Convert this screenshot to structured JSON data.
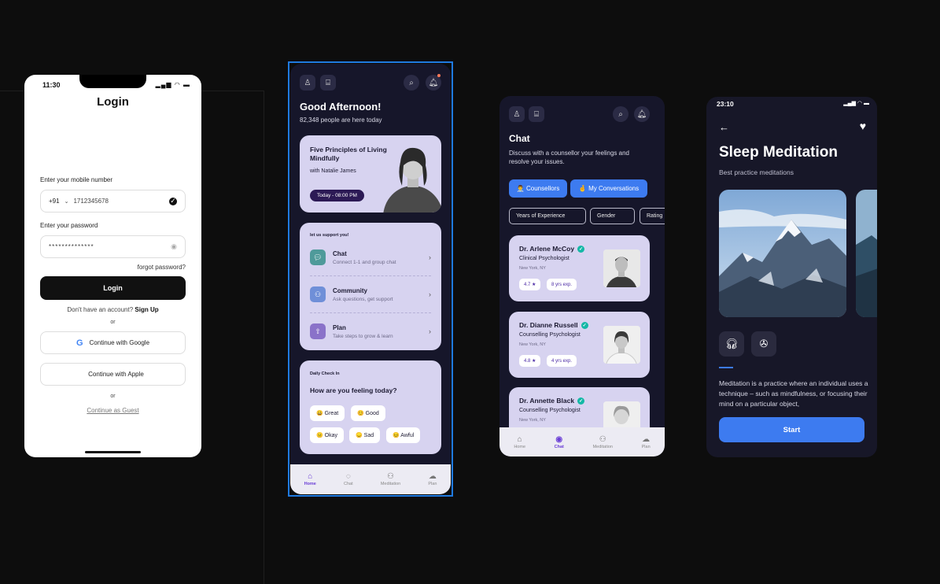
{
  "login": {
    "time": "11:30",
    "title": "Login",
    "mobile_label": "Enter your mobile number",
    "country_code": "+91",
    "phone_value": "1712345678",
    "password_label": "Enter your password",
    "password_value": "**************",
    "forgot": "forgot password?",
    "login_button": "Login",
    "no_account": "Don't have an account?",
    "signup": "Sign Up",
    "or1": "or",
    "google": "Continue with Google",
    "apple": "Continue with Apple",
    "or2": "or",
    "guest": "Continue as Guest"
  },
  "home": {
    "greeting": "Good Afternoon!",
    "people_count": "82,348 people are here today",
    "hero": {
      "title": "Five Principles of Living Mindfully",
      "host": "with Natalie James",
      "time_pill": "Today - 08:00 PM"
    },
    "support": {
      "caption": "let us support you!",
      "items": [
        {
          "title": "Chat",
          "subtitle": "Connect 1-1 and group chat",
          "color": "#4f9a9a"
        },
        {
          "title": "Community",
          "subtitle": "Ask questions, get support",
          "color": "#6f8fd8"
        },
        {
          "title": "Plan",
          "subtitle": "Take steps to grow & learn",
          "color": "#8a72c9"
        }
      ]
    },
    "checkin": {
      "caption": "Daily Check In",
      "question": "How are you feeling today?",
      "moods": [
        "😀 Great",
        "😊 Good",
        "😐 Okay",
        "😞 Sad",
        "😣 Awful"
      ]
    },
    "tabs": [
      "Home",
      "Chat",
      "Meditation",
      "Plan"
    ]
  },
  "chat": {
    "title": "Chat",
    "description": "Discuss with a counsellor your feelings and resolve your issues.",
    "btn_counsellors": "👨‍⚕️ Counsellors",
    "btn_conversations": "🤞 My Conversations",
    "filters": [
      "Years of Experience",
      "Gender",
      "Rating"
    ],
    "counsellors": [
      {
        "name": "Dr. Arlene McCoy",
        "role": "Clinical Psychologist",
        "location": "New York, NY",
        "rating": "4.7 ★",
        "exp": "8 yrs exp."
      },
      {
        "name": "Dr. Dianne Russell",
        "role": "Counselling Psychologist",
        "location": "New York, NY",
        "rating": "4.8 ★",
        "exp": "4 yrs exp."
      },
      {
        "name": "Dr. Annette Black",
        "role": "Counselling Psychologist",
        "location": "New York, NY",
        "rating": "",
        "exp": ""
      }
    ],
    "tabs": [
      "Home",
      "Chat",
      "Meditation",
      "Plan"
    ]
  },
  "meditation": {
    "time": "23:10",
    "title": "Sleep Meditation",
    "subtitle": "Best practice meditations",
    "body": "Meditation is a practice where an individual uses a technique – such as mindfulness, or focusing their mind on a particular object,",
    "start": "Start"
  },
  "colors": {
    "accent_blue": "#3d7bf0",
    "card_lavender": "#d7d3f0",
    "dark_bg": "#16162a",
    "active_tab": "#6b3fd6"
  }
}
